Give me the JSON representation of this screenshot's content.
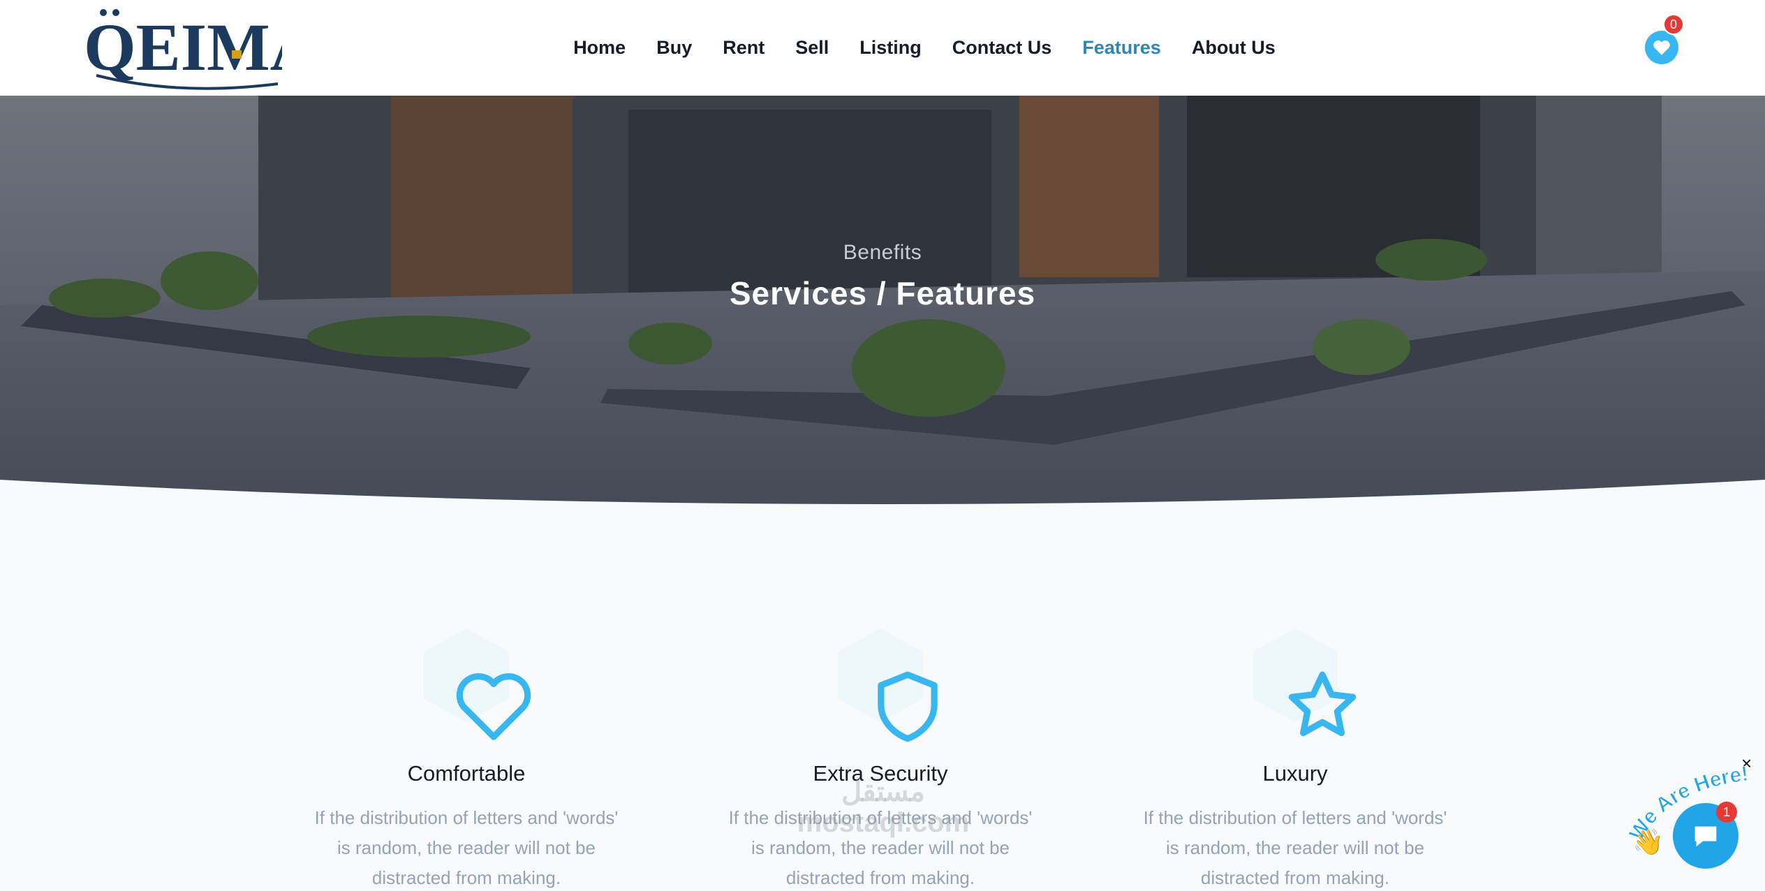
{
  "brand": {
    "logo_text": "QEIMA"
  },
  "nav": {
    "items": [
      {
        "label": "Home"
      },
      {
        "label": "Buy"
      },
      {
        "label": "Rent"
      },
      {
        "label": "Sell"
      },
      {
        "label": "Listing"
      },
      {
        "label": "Contact Us"
      },
      {
        "label": "Features"
      },
      {
        "label": "About Us"
      }
    ],
    "active": "Features"
  },
  "wishlist": {
    "count": "0",
    "icon": "heart-icon"
  },
  "hero": {
    "subtitle": "Benefits",
    "title": "Services / Features"
  },
  "features": [
    {
      "icon": "heart-icon",
      "title": "Comfortable",
      "text": "If the distribution of letters and 'words' is random, the reader will not be distracted from making."
    },
    {
      "icon": "shield-icon",
      "title": "Extra Security",
      "text": "If the distribution of letters and 'words' is random, the reader will not be distracted from making."
    },
    {
      "icon": "star-icon",
      "title": "Luxury",
      "text": "If the distribution of letters and 'words' is random, the reader will not be distracted from making."
    }
  ],
  "watermark": {
    "text_ar": "مستقل",
    "text_en": "mostaql.com"
  },
  "chat": {
    "tag": "We Are Here!",
    "badge": "1",
    "close": "×"
  },
  "colors": {
    "accent": "#38b6f0",
    "nav_active": "#2d87b5",
    "text_dark": "#161c2d",
    "muted": "#94a3b8"
  }
}
